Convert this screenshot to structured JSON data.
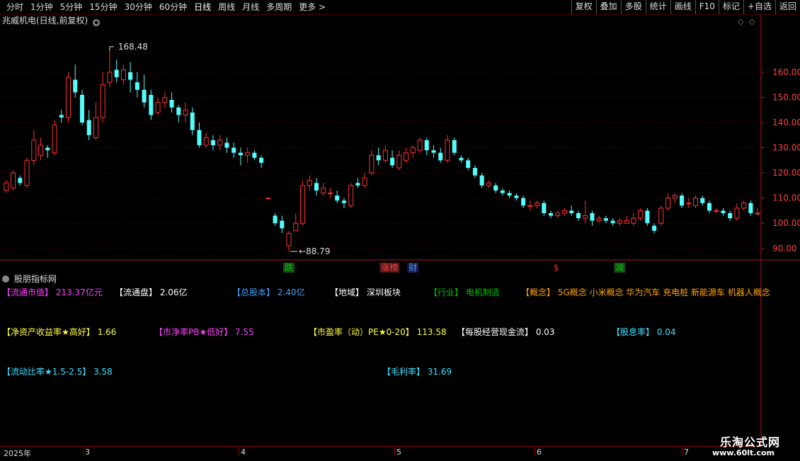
{
  "toolbar": {
    "periods": [
      "分时",
      "1分钟",
      "5分钟",
      "15分钟",
      "30分钟",
      "60分钟",
      "日线",
      "周线",
      "月线",
      "多周期",
      "更多 >"
    ],
    "active_period": "日线",
    "right_buttons": [
      "复权",
      "叠加",
      "多股",
      "统计",
      "画线",
      "F10",
      "标记",
      "+自选",
      "返回"
    ]
  },
  "chart_title": "兆威机电(日线,前复权)",
  "indicator_panel_title": "股朋指标网",
  "indicators_row1": [
    {
      "label": "【流通市值】",
      "value": "213.37亿元",
      "color": "#ff40ff"
    },
    {
      "label": "【流通盘】",
      "value": "2.06亿",
      "color": "#ffffff"
    },
    {
      "label": "【总股本】",
      "value": "2.40亿",
      "color": "#40a0ff"
    },
    {
      "label": "【地域】",
      "value": "深圳板块",
      "color": "#ffffff"
    },
    {
      "label": "【行业】",
      "value": "电机制造",
      "color": "#00c000"
    },
    {
      "label": "【概念】",
      "value": "5G概念 小米概念 华为汽车 充电桩 新能源车 机器人概念",
      "color": "#ffa500"
    }
  ],
  "indicators_row2": [
    {
      "label": "【净资产收益率★高好】",
      "value": "1.66",
      "color": "#ffff40"
    },
    {
      "label": "【市净率PB★低好】",
      "value": "7.55",
      "color": "#ff40ff"
    },
    {
      "label": "【市盈率（动）PE★0-20】",
      "value": "113.58",
      "color": "#ffff40"
    },
    {
      "label": "【每股经营现金流】",
      "value": "0.03",
      "color": "#ffffff"
    },
    {
      "label": "【股息率】",
      "value": "0.04",
      "color": "#40e0ff"
    }
  ],
  "indicators_row3": [
    {
      "label": "【流动比率★1.5-2.5】",
      "value": "3.58",
      "color": "#40e0ff"
    },
    {
      "label": "【毛利率】",
      "value": "31.69",
      "color": "#40e0ff"
    }
  ],
  "dates": {
    "year_label": "2025年",
    "months": [
      "3",
      "4",
      "5",
      "6",
      "7"
    ]
  },
  "event_markers": [
    {
      "text": "跌",
      "index": 41,
      "color": "#00c000",
      "bg": "#1a4a1a"
    },
    {
      "text": "涨榜",
      "index": 55,
      "color": "#ff4040",
      "bg": "#4a1a1a"
    },
    {
      "text": "财",
      "index": 59,
      "color": "#40a0ff",
      "bg": "#1a1a4a"
    },
    {
      "text": "$",
      "index": 80,
      "color": "#ff2020",
      "bg": "none"
    },
    {
      "text": "减",
      "index": 89,
      "color": "#00c000",
      "bg": "#1a4a1a"
    }
  ],
  "watermark": {
    "main": "乐淘公式网",
    "sub": "www.60lt.com"
  },
  "colors": {
    "up": "#ff3232",
    "down": "#54fcfc",
    "grid": "#7a0000",
    "axis": "#c01010"
  },
  "chart_data": {
    "type": "candlestick",
    "title": "兆威机电(日线,前复权)",
    "ylim": [
      86,
      178
    ],
    "yticks": [
      90.0,
      100.0,
      110.0,
      120.0,
      130.0,
      140.0,
      150.0,
      160.0
    ],
    "annotations": [
      {
        "text": "168.48",
        "index": 15,
        "value": 168.48,
        "type": "high"
      },
      {
        "text": "88.79",
        "index": 41,
        "value": 88.79,
        "type": "low"
      }
    ],
    "candles": [
      [
        113,
        116,
        112,
        117
      ],
      [
        114,
        120,
        113,
        121
      ],
      [
        118,
        116,
        115,
        119
      ],
      [
        115,
        125,
        114,
        126
      ],
      [
        125,
        133,
        123,
        137
      ],
      [
        127,
        131,
        125,
        134
      ],
      [
        130,
        129,
        126,
        131
      ],
      [
        128,
        139,
        127,
        141
      ],
      [
        143,
        142,
        140,
        145
      ],
      [
        142,
        158,
        140,
        160
      ],
      [
        157,
        152,
        150,
        163
      ],
      [
        151,
        140,
        139,
        153
      ],
      [
        141,
        135,
        133,
        145
      ],
      [
        134,
        142,
        133,
        148
      ],
      [
        142,
        155,
        140,
        160
      ],
      [
        156,
        160,
        154,
        168.48
      ],
      [
        161,
        158,
        156,
        165
      ],
      [
        157,
        161,
        155,
        163
      ],
      [
        160,
        157,
        152,
        164
      ],
      [
        156,
        153,
        150,
        160
      ],
      [
        153,
        148,
        146,
        159
      ],
      [
        151,
        143,
        141,
        153
      ],
      [
        144,
        148,
        143,
        150
      ],
      [
        148,
        150,
        146,
        152
      ],
      [
        149,
        146,
        144,
        152
      ],
      [
        146,
        143,
        140,
        147
      ],
      [
        143,
        145,
        140,
        148
      ],
      [
        144,
        137,
        135,
        146
      ],
      [
        137,
        131,
        130,
        140
      ],
      [
        131,
        134,
        130,
        136
      ],
      [
        133,
        131,
        129,
        135
      ],
      [
        131,
        133,
        129,
        135
      ],
      [
        132,
        130,
        128,
        134
      ],
      [
        130,
        128,
        126,
        132
      ],
      [
        128,
        127,
        123,
        130
      ],
      [
        127,
        128,
        124,
        130
      ],
      [
        128,
        126,
        125,
        129
      ],
      [
        126,
        124,
        122,
        127
      ],
      [
        110,
        110,
        110,
        110
      ],
      [
        103,
        100,
        99,
        104
      ],
      [
        101,
        98,
        96,
        103
      ],
      [
        91,
        96,
        88.79,
        97
      ],
      [
        97,
        100,
        97,
        104
      ],
      [
        100,
        115,
        99,
        117
      ],
      [
        115,
        117,
        113,
        119
      ],
      [
        116,
        113,
        111,
        118
      ],
      [
        112,
        114,
        111,
        116
      ],
      [
        112,
        112,
        110,
        114
      ],
      [
        111,
        109,
        108,
        113
      ],
      [
        109,
        108,
        106,
        110
      ],
      [
        107,
        115,
        106,
        116
      ],
      [
        116,
        115,
        114,
        118
      ],
      [
        115,
        118,
        114,
        120
      ],
      [
        120,
        127,
        119,
        129
      ],
      [
        127,
        125,
        123,
        130
      ],
      [
        125,
        129,
        124,
        131
      ],
      [
        126,
        123,
        122,
        129
      ],
      [
        122,
        127,
        121,
        129
      ],
      [
        125,
        128,
        124,
        130
      ],
      [
        128,
        130,
        126,
        131
      ],
      [
        129,
        133,
        128,
        134
      ],
      [
        133,
        129,
        127,
        134
      ],
      [
        129,
        128,
        126,
        131
      ],
      [
        128,
        125,
        124,
        130
      ],
      [
        125,
        133,
        124,
        135
      ],
      [
        133,
        128,
        127,
        134
      ],
      [
        126,
        125,
        124,
        127
      ],
      [
        125,
        122,
        121,
        126
      ],
      [
        122,
        119,
        118,
        123
      ],
      [
        119,
        115,
        114,
        120
      ],
      [
        115,
        116,
        114,
        117
      ],
      [
        115,
        113,
        112,
        116
      ],
      [
        113,
        112,
        111,
        114
      ],
      [
        112,
        111,
        110,
        113
      ],
      [
        111,
        110,
        109,
        112
      ],
      [
        110,
        107,
        106,
        111
      ],
      [
        107,
        107,
        105,
        109
      ],
      [
        107,
        108,
        106,
        109
      ],
      [
        108,
        104,
        103,
        109
      ],
      [
        104,
        103,
        102,
        105
      ],
      [
        103,
        104,
        102,
        105
      ],
      [
        104,
        105,
        103,
        106
      ],
      [
        105,
        104,
        103,
        107
      ],
      [
        104,
        102,
        101,
        105
      ],
      [
        102,
        103,
        100,
        109
      ],
      [
        104,
        101,
        99,
        105
      ],
      [
        101,
        102,
        100,
        103
      ],
      [
        102,
        101,
        100,
        103
      ],
      [
        101,
        100,
        99,
        102
      ],
      [
        100,
        101,
        99,
        102
      ],
      [
        100,
        101,
        100,
        103
      ],
      [
        100,
        102,
        99,
        104
      ],
      [
        102,
        105,
        101,
        106
      ],
      [
        105,
        100,
        99,
        106
      ],
      [
        99,
        97,
        96,
        100
      ],
      [
        100,
        106,
        99,
        107
      ],
      [
        106,
        110,
        105,
        112
      ],
      [
        110,
        111,
        108,
        112
      ],
      [
        111,
        107,
        106,
        112
      ],
      [
        108,
        108,
        106,
        110
      ],
      [
        107,
        110,
        106,
        111
      ],
      [
        110,
        108,
        107,
        111
      ],
      [
        108,
        105,
        104,
        109
      ],
      [
        105,
        105,
        104,
        106
      ],
      [
        105,
        104,
        103,
        106
      ],
      [
        104,
        102,
        101,
        105
      ],
      [
        102,
        106,
        101,
        108
      ],
      [
        106,
        108,
        105,
        109
      ],
      [
        108,
        104,
        103,
        109
      ],
      [
        104,
        104,
        103,
        106
      ]
    ]
  }
}
